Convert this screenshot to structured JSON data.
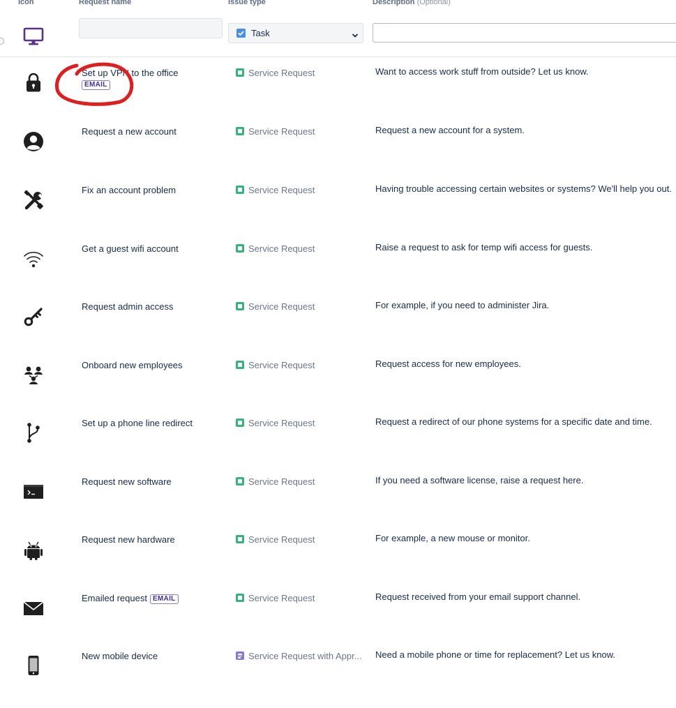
{
  "headers": {
    "icon": "Icon",
    "request_name": "Request name",
    "issue_type": "Issue type",
    "description": "Description",
    "description_optional": "(Optional)"
  },
  "new_row": {
    "icon": "monitor-icon",
    "name_value": "",
    "issue_type_selected": "Task",
    "description_value": ""
  },
  "colors": {
    "service_request": "#36b37e",
    "service_request_approval": "#8777d9",
    "email_lozenge": "#403294",
    "annotation": "#e01e1e",
    "task_checkbox": "#4a90e2"
  },
  "rows": [
    {
      "icon": "lock-icon",
      "name": "Set up VPN to the office",
      "badge": "EMAIL",
      "issue_type": "Service Request",
      "description": "Want to access work stuff from outside? Let us know."
    },
    {
      "icon": "account-icon",
      "name": "Request a new account",
      "badge": "",
      "issue_type": "Service Request",
      "description": "Request a new account for a system."
    },
    {
      "icon": "tools-icon",
      "name": "Fix an account problem",
      "badge": "",
      "issue_type": "Service Request",
      "description": "Having trouble accessing certain websites or systems? We'll help you out."
    },
    {
      "icon": "wifi-icon",
      "name": "Get a guest wifi account",
      "badge": "",
      "issue_type": "Service Request",
      "description": "Raise a request to ask for temp wifi access for guests."
    },
    {
      "icon": "key-icon",
      "name": "Request admin access",
      "badge": "",
      "issue_type": "Service Request",
      "description": "For example, if you need to administer Jira."
    },
    {
      "icon": "people-icon",
      "name": "Onboard new employees",
      "badge": "",
      "issue_type": "Service Request",
      "description": "Request access for new employees."
    },
    {
      "icon": "branch-icon",
      "name": "Set up a phone line redirect",
      "badge": "",
      "issue_type": "Service Request",
      "description": "Request a redirect of our phone systems for a specific date and time."
    },
    {
      "icon": "terminal-icon",
      "name": "Request new software",
      "badge": "",
      "issue_type": "Service Request",
      "description": "If you need a software license, raise a request here."
    },
    {
      "icon": "android-icon",
      "name": "Request new hardware",
      "badge": "",
      "issue_type": "Service Request",
      "description": "For example, a new mouse or monitor."
    },
    {
      "icon": "envelope-icon",
      "name": "Emailed request",
      "badge": "EMAIL",
      "issue_type": "Service Request",
      "description": "Request received from your email support channel."
    },
    {
      "icon": "mobile-icon",
      "name": "New mobile device",
      "badge": "",
      "issue_type": "Service Request with Appr...",
      "description": "Need a mobile phone or time for replacement? Let us know."
    }
  ]
}
